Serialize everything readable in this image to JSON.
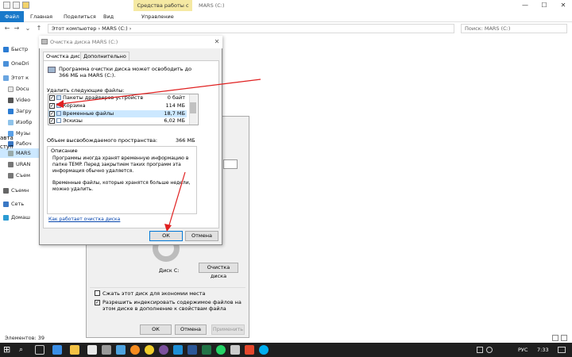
{
  "explorer": {
    "ribbon_tools": "Средства работы с дисками",
    "title": "MARS (C:)",
    "tabs": [
      "Файл",
      "Главная",
      "Поделиться",
      "Вид",
      "Управление"
    ],
    "address": "Этот компьютер  ›  MARS (C:)  ›",
    "search_placeholder": "Поиск: MARS (C:)",
    "nav_items": [
      "Быстр",
      "OneDri",
      "Этот к",
      "Docu",
      "Video",
      "Загру",
      "Изобр",
      "Музы",
      "Рабоч",
      "MARS",
      "URAN",
      "Съем",
      "Съемн",
      "Сеть",
      "Домаш"
    ],
    "status": "Элементов: 39"
  },
  "properties": {
    "col_fragments": [
      "авта",
      "ступ"
    ],
    "disk_label": "Диск С:",
    "cleanup_btn": "Очистка диска",
    "compress_label": "Сжать этот диск для экономии места",
    "index_label": "Разрешить индексировать содержимое файлов на этом диске в дополнение к свойствам файла",
    "ok": "ОК",
    "cancel": "Отмена",
    "apply": "Применить"
  },
  "cleanup": {
    "title": "Очистка диска MARS (C:)",
    "tabs": [
      "Очистка диска",
      "Дополнительно"
    ],
    "intro": "Программа очистки диска может освободить до 366 МБ на MARS (C:).",
    "delete_label": "Удалить следующие файлы:",
    "files": [
      {
        "name": "Пакеты драйверов устройств",
        "size": "0 байт",
        "checked": true
      },
      {
        "name": "Корзина",
        "size": "114 МБ",
        "checked": true
      },
      {
        "name": "Временные файлы",
        "size": "18,7 МБ",
        "checked": true
      },
      {
        "name": "Эскизы",
        "size": "6,02 МБ",
        "checked": true
      }
    ],
    "total_label": "Объем высвобождаемого пространства:",
    "total_value": "366 МБ",
    "desc_title": "Описание",
    "desc_text1": "Программы иногда хранят временную информацию в папке TEMP. Перед закрытием таких программ эта информация обычно удаляется.",
    "desc_text2": "Временные файлы, которые хранятся больше недели, можно удалить.",
    "link": "Как работает очистка диска",
    "ok": "ОК",
    "cancel": "Отмена"
  },
  "taskbar": {
    "lang": "РУС",
    "time": "7:33"
  },
  "colors": {
    "accent": "#1979ca",
    "tools_tab": "#f5e9a3",
    "annotation": "#e02020"
  }
}
